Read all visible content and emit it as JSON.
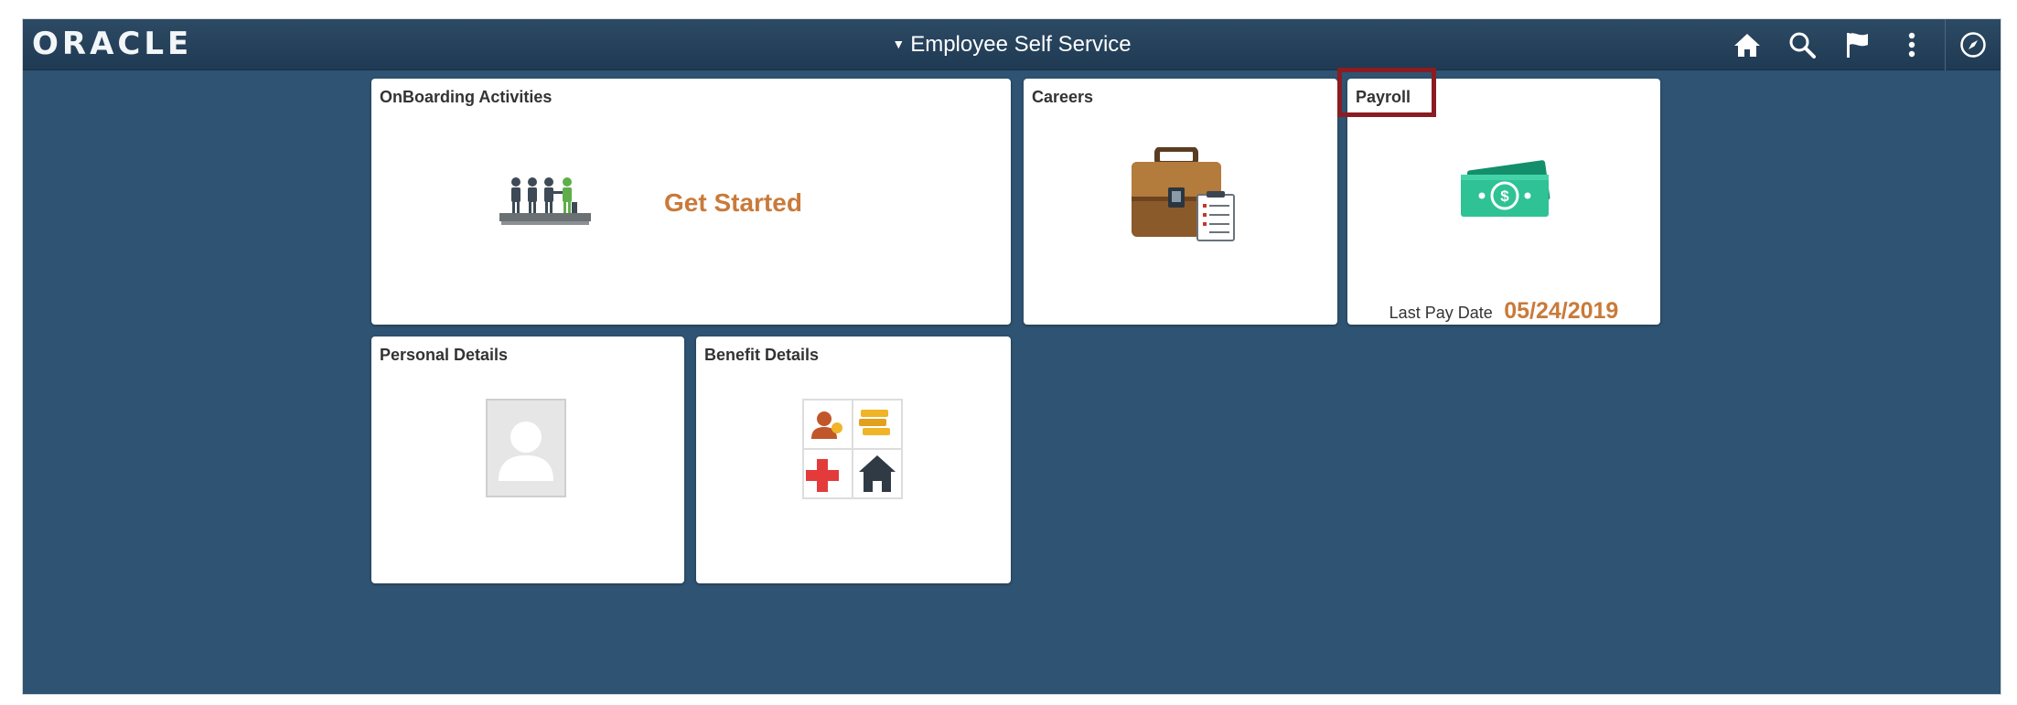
{
  "header": {
    "logo_text": "ORACLE",
    "title": "Employee Self Service",
    "title_caret": "▼",
    "icons": [
      "home-icon",
      "search-icon",
      "flag-icon",
      "more-options-icon",
      "navbar-icon"
    ]
  },
  "tiles": {
    "onboarding": {
      "title": "OnBoarding Activities",
      "action": "Get Started",
      "icon": "onboarding-people-icon"
    },
    "careers": {
      "title": "Careers",
      "icon": "briefcase-icon"
    },
    "payroll": {
      "title": "Payroll",
      "icon": "money-icon",
      "last_pay_label": "Last Pay Date",
      "last_pay_value": "05/24/2019",
      "highlighted": true
    },
    "personal": {
      "title": "Personal Details",
      "icon": "person-placeholder-icon"
    },
    "benefit": {
      "title": "Benefit Details",
      "icon": "benefits-grid-icon"
    }
  },
  "colors": {
    "background": "#2f5372",
    "header": "#1f3a53",
    "accent": "#c97a3a",
    "highlight": "#8a1c22"
  }
}
